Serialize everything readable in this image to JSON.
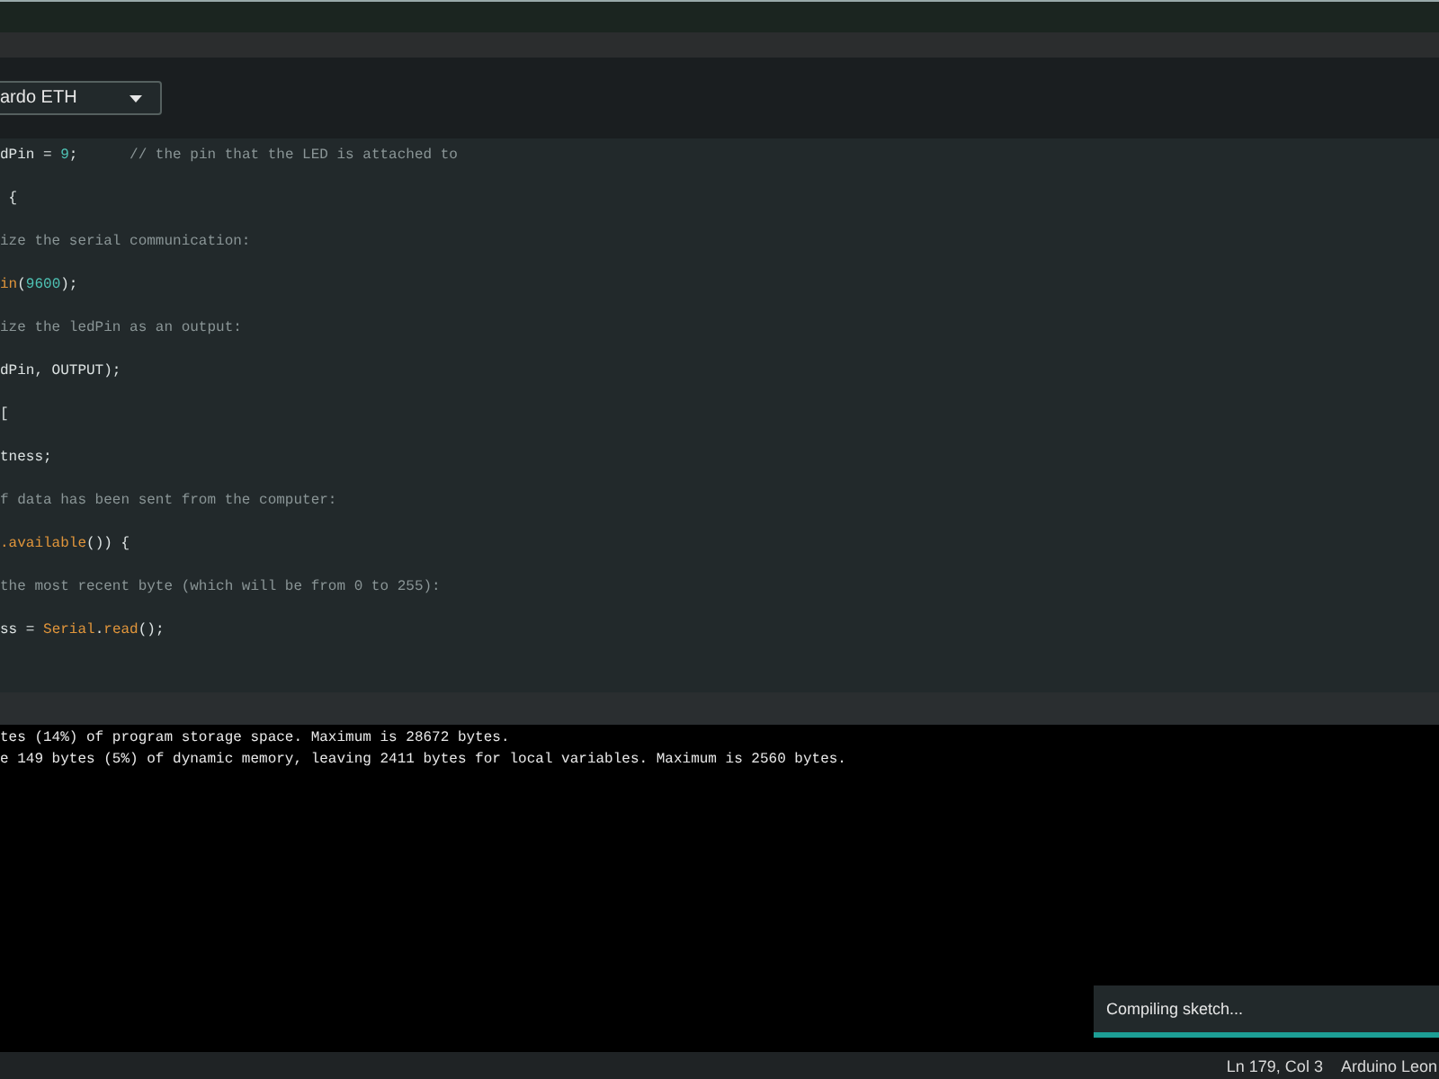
{
  "board_selector": {
    "value": "ardo ETH"
  },
  "editor": {
    "lines": [
      [
        {
          "kind": "plain",
          "text": "dPin = "
        },
        {
          "kind": "number",
          "text": "9"
        },
        {
          "kind": "plain",
          "text": ";      "
        },
        {
          "kind": "comment",
          "text": "// the pin that the LED is attached to"
        }
      ],
      [
        {
          "kind": "plain",
          "text": " {"
        }
      ],
      [
        {
          "kind": "comment",
          "text": "ize the serial communication:"
        }
      ],
      [
        {
          "kind": "function",
          "text": "in"
        },
        {
          "kind": "plain",
          "text": "("
        },
        {
          "kind": "number",
          "text": "9600"
        },
        {
          "kind": "plain",
          "text": ");"
        }
      ],
      [
        {
          "kind": "comment",
          "text": "ize the ledPin as an output:"
        }
      ],
      [
        {
          "kind": "plain",
          "text": "dPin, OUTPUT);"
        }
      ],
      [
        {
          "kind": "plain",
          "text": "["
        }
      ],
      [
        {
          "kind": "plain",
          "text": "tness;"
        }
      ],
      [
        {
          "kind": "comment",
          "text": "f data has been sent from the computer:"
        }
      ],
      [
        {
          "kind": "function",
          "text": ".available"
        },
        {
          "kind": "plain",
          "text": "()) {"
        }
      ],
      [
        {
          "kind": "comment",
          "text": "the most recent byte (which will be from 0 to 255):"
        }
      ],
      [
        {
          "kind": "plain",
          "text": "ss = "
        },
        {
          "kind": "function",
          "text": "Serial"
        },
        {
          "kind": "plain",
          "text": "."
        },
        {
          "kind": "function",
          "text": "read"
        },
        {
          "kind": "plain",
          "text": "();"
        }
      ]
    ]
  },
  "output": {
    "lines": [
      "tes (14%) of program storage space. Maximum is 28672 bytes.",
      "e 149 bytes (5%) of dynamic memory, leaving 2411 bytes for local variables. Maximum is 2560 bytes."
    ]
  },
  "notification": {
    "text": "Compiling sketch...",
    "level": 1
  },
  "status_bar": {
    "position": "Ln 179, Col 3",
    "board": "Arduino Leon"
  }
}
